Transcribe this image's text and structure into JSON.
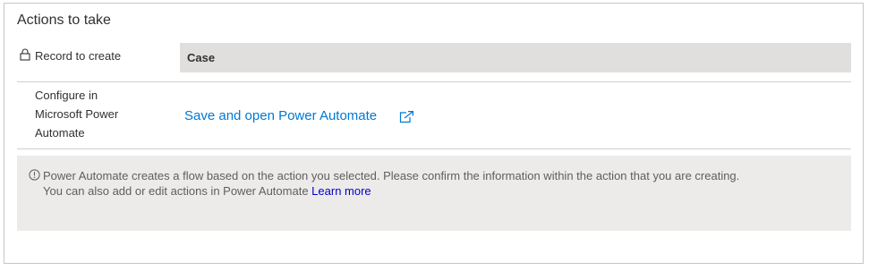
{
  "section": {
    "title": "Actions to take"
  },
  "record": {
    "label": "Record to create",
    "value": "Case",
    "icon": "lock-icon"
  },
  "configure": {
    "label_lines": [
      "Configure in",
      "Microsoft Power",
      "Automate"
    ],
    "link_label": "Save and open Power Automate",
    "link_icon": "external-link-icon"
  },
  "info": {
    "icon": "info-icon",
    "line1": "Power Automate creates a flow based on the action you selected. Please confirm the information within the action that you are creating.",
    "line2": "You can also add or edit actions in Power Automate",
    "learn_more": "Learn more"
  },
  "colors": {
    "link": "#0078d4",
    "learn_more": "#0000cc",
    "readonly_field_bg": "#e1dfdd",
    "info_bg": "#edebe9"
  }
}
